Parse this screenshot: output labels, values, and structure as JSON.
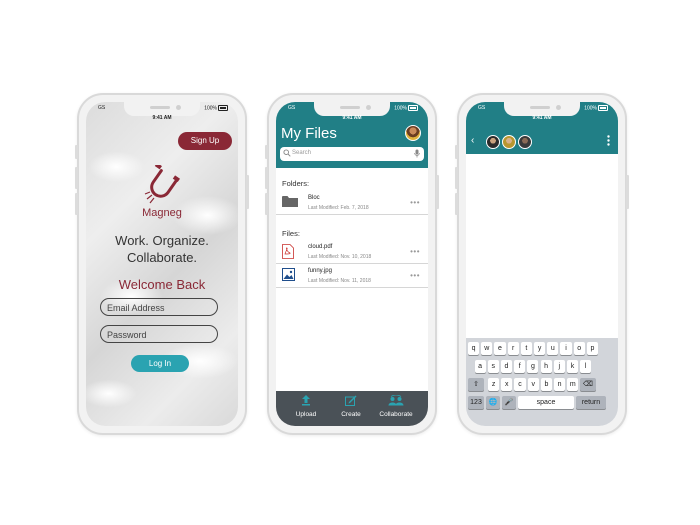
{
  "phone1": {
    "status": {
      "carrier": "GS",
      "time": "9:41 AM",
      "battery": "100%"
    },
    "signup_label": "Sign Up",
    "brand": "Magneg",
    "tagline_line1": "Work. Organize.",
    "tagline_line2": "Collaborate.",
    "welcome": "Welcome Back",
    "email_placeholder": "Email Address",
    "password_placeholder": "Password",
    "login_label": "Log In",
    "colors": {
      "accent": "#8a2836",
      "button": "#2aa3b1"
    }
  },
  "phone2": {
    "status": {
      "carrier": "GS",
      "time": "9:41 AM",
      "battery": "100%"
    },
    "title": "My Files",
    "search_placeholder": "Search",
    "folders_heading": "Folders:",
    "folders": [
      {
        "name": "Bloc",
        "meta": "Last Modified:  Feb. 7, 2018",
        "icon": "folder-icon"
      }
    ],
    "files_heading": "Files:",
    "files": [
      {
        "name": "cloud.pdf",
        "meta": "Last Modified:  Nov. 10, 2018",
        "icon": "pdf-icon"
      },
      {
        "name": "funny.jpg",
        "meta": "Last Modified:  Nov. 11, 2018",
        "icon": "image-icon"
      }
    ],
    "more": "•••",
    "tabs": [
      {
        "label": "Upload",
        "icon": "upload-icon"
      },
      {
        "label": "Create",
        "icon": "create-icon"
      },
      {
        "label": "Collaborate",
        "icon": "collaborate-icon"
      }
    ],
    "colors": {
      "header": "#217f86",
      "tabbar": "#4a5157"
    }
  },
  "phone3": {
    "status": {
      "carrier": "GS",
      "time": "9:41 AM",
      "battery": "100%"
    },
    "back": "‹",
    "more": "⋮",
    "keyboard": {
      "row1": [
        "q",
        "w",
        "e",
        "r",
        "t",
        "y",
        "u",
        "i",
        "o",
        "p"
      ],
      "row2": [
        "a",
        "s",
        "d",
        "f",
        "g",
        "h",
        "j",
        "k",
        "l"
      ],
      "row3": [
        "z",
        "x",
        "c",
        "v",
        "b",
        "n",
        "m"
      ],
      "shift": "⇧",
      "delete": "⌫",
      "numbers": "123",
      "globe": "🌐",
      "mic": "🎤",
      "space": "space",
      "return": "return"
    }
  }
}
